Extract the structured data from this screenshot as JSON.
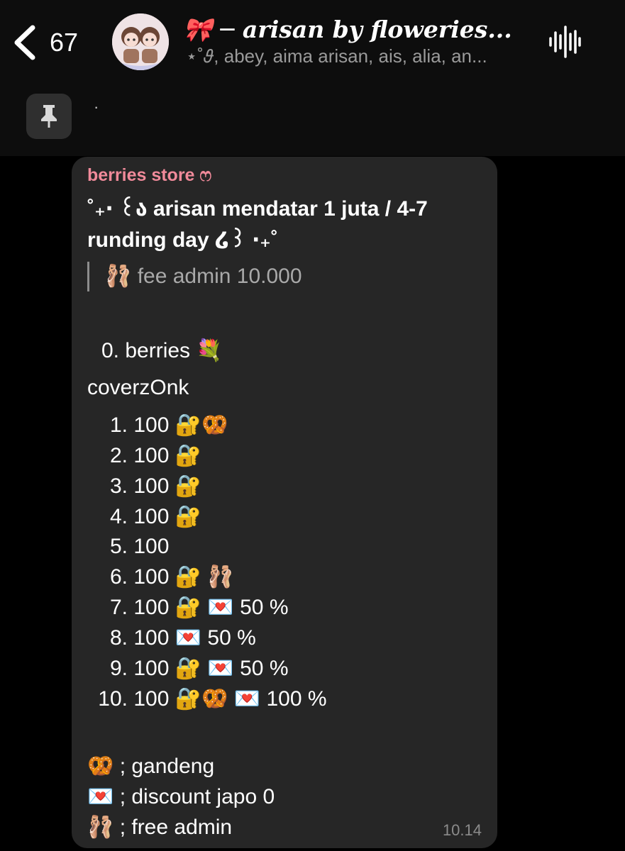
{
  "header": {
    "back_count": "67",
    "title": "🎀 ─ arisan by floweries...",
    "subtitle": "⋆˚𝜗, abey, aima arisan, ais, alia, an..."
  },
  "pinned": {
    "text": "·"
  },
  "message": {
    "sender": "berries store ෆ",
    "headline": "˚₊‧ ꒰ა arisan mendatar 1 juta / 4-7 runding day ໒꒱ ‧₊˚",
    "quote": "🩰 fee admin 10.000",
    "owner": "0. berries 💐",
    "cover": "coverzOnk",
    "slots": [
      {
        "num": "1.",
        "text": "100 🔐🥨"
      },
      {
        "num": "2.",
        "text": "100 🔐"
      },
      {
        "num": "3.",
        "text": "100 🔐"
      },
      {
        "num": "4.",
        "text": "100 🔐"
      },
      {
        "num": "5.",
        "text": "100"
      },
      {
        "num": "6.",
        "text": "100 🔐 🩰"
      },
      {
        "num": "7.",
        "text": "100 🔐 💌 50 %"
      },
      {
        "num": "8.",
        "text": "100 💌 50 %"
      },
      {
        "num": "9.",
        "text": "100 🔐 💌 50 %"
      },
      {
        "num": "10.",
        "text": "100 🔐🥨 💌 100 %"
      }
    ],
    "legend": [
      "🥨 ; gandeng",
      "💌 ; discount japo 0",
      "🩰 ; free admin"
    ],
    "time": "10.14"
  }
}
